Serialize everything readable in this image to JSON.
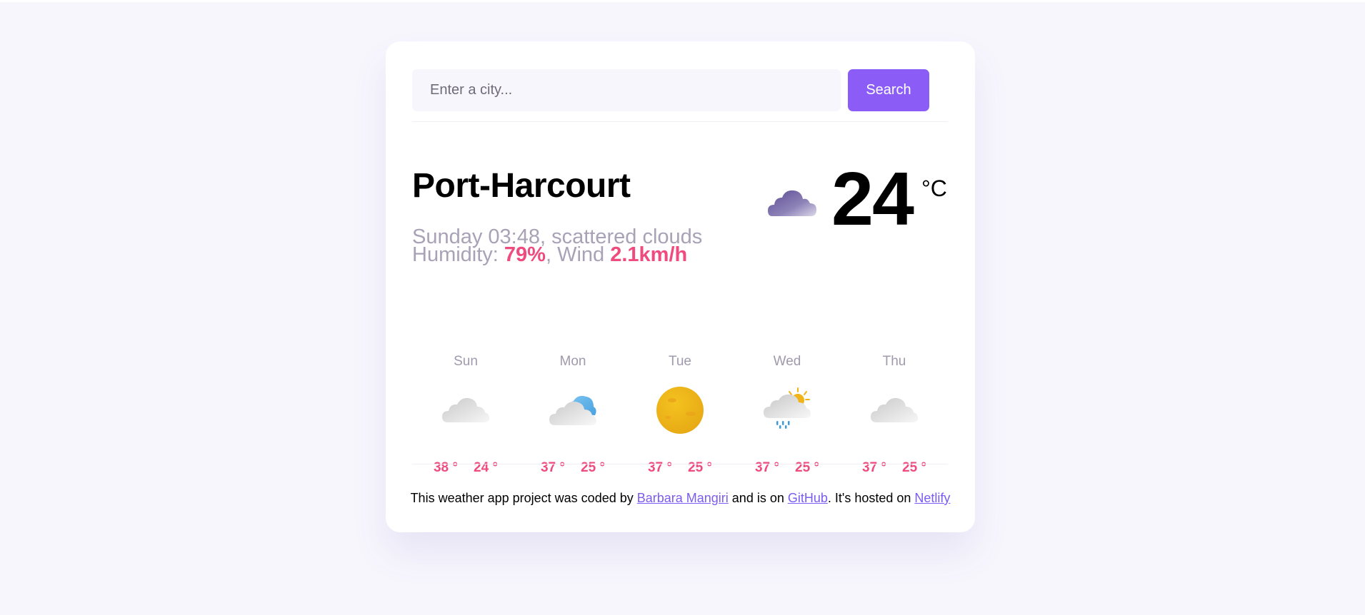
{
  "search": {
    "placeholder": "Enter a city...",
    "button_label": "Search"
  },
  "current": {
    "city": "Port-Harcourt",
    "day_time": "Sunday 03:48",
    "separator": ",",
    "description": " scattered clouds",
    "humidity_label": "Humidity: ",
    "humidity_value": "79%",
    "wind_label": ", Wind ",
    "wind_value": "2.1km/h",
    "temperature": "24",
    "unit": "°C",
    "icon": "scattered-clouds-icon"
  },
  "forecast": [
    {
      "day": "Sun",
      "max": "38 °",
      "min": "24 °",
      "icon": "broken-clouds-icon"
    },
    {
      "day": "Mon",
      "max": "37 °",
      "min": "25 °",
      "icon": "few-clouds-icon"
    },
    {
      "day": "Tue",
      "max": "37 °",
      "min": "25 °",
      "icon": "sun-icon"
    },
    {
      "day": "Wed",
      "max": "37 °",
      "min": "25 °",
      "icon": "sun-rain-icon"
    },
    {
      "day": "Thu",
      "max": "37 °",
      "min": "25 °",
      "icon": "broken-clouds-icon"
    }
  ],
  "footer": {
    "text_1": "This weather app project was coded by ",
    "author_link": "Barbara Mangiri",
    "text_2": " and is on ",
    "github_link": "GitHub",
    "text_3": ". It's hosted on ",
    "netlify_link": "Netlify"
  },
  "colors": {
    "accent": "#8b5cf6",
    "highlight": "#ef4b7e",
    "muted_text": "#a9a2b6",
    "background": "#f7f6fd"
  }
}
